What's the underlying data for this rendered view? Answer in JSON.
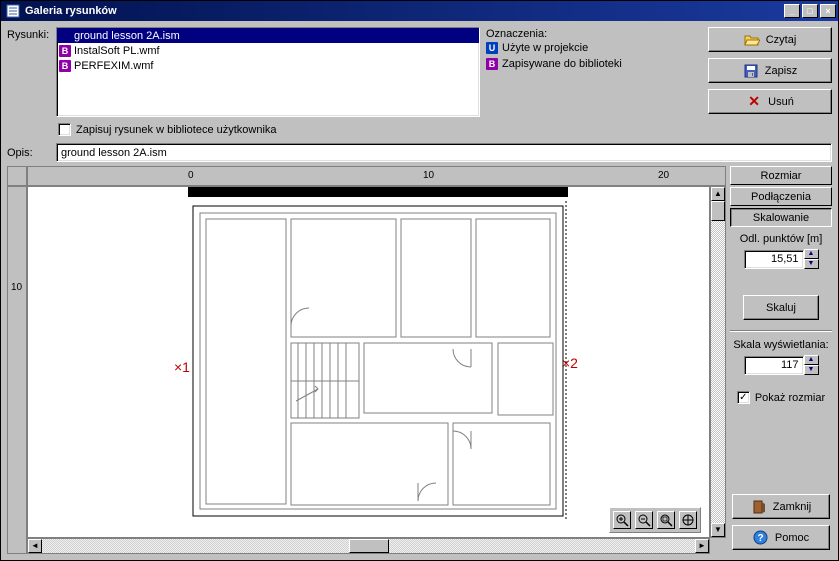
{
  "window": {
    "title": "Galeria rysunków"
  },
  "labels": {
    "rysunki": "Rysunki:",
    "oznaczenia": "Oznaczenia:",
    "uzyte": "Użyte w projekcie",
    "zapisywane": "Zapisywane do biblioteki",
    "checkbox_save_lib": "Zapisuj rysunek w bibliotece użytkownika",
    "opis": "Opis:",
    "odl_punktow": "Odl. punktów [m]",
    "skala_wys": "Skala wyświetlania:",
    "pokaz_rozmiar": "Pokaż rozmiar"
  },
  "file_list": [
    {
      "badge": "",
      "name": "ground lesson 2A.ism",
      "selected": true
    },
    {
      "badge": "B",
      "name": "InstalSoft PL.wmf",
      "selected": false
    },
    {
      "badge": "B",
      "name": "PERFEXIM.wmf",
      "selected": false
    }
  ],
  "opis_value": "ground lesson 2A.ism",
  "buttons": {
    "czytaj": "Czytaj",
    "zapisz": "Zapisz",
    "usun": "Usuń",
    "skaluj": "Skaluj",
    "zamknij": "Zamknij",
    "pomoc": "Pomoc"
  },
  "tabs": {
    "rozmiar": "Rozmiar",
    "podlaczenia": "Podłączenia",
    "skalowanie": "Skalowanie"
  },
  "values": {
    "odl_punktow": "15,51",
    "skala_wys": "117",
    "pokaz_rozmiar_checked": true
  },
  "ruler": {
    "h_ticks": [
      {
        "label": "0",
        "pos": 160
      },
      {
        "label": "10",
        "pos": 395
      },
      {
        "label": "20",
        "pos": 630
      }
    ],
    "v_ticks": [
      {
        "label": "10",
        "pos": 95
      }
    ]
  },
  "markers": {
    "left": "×1",
    "right": "×2"
  }
}
